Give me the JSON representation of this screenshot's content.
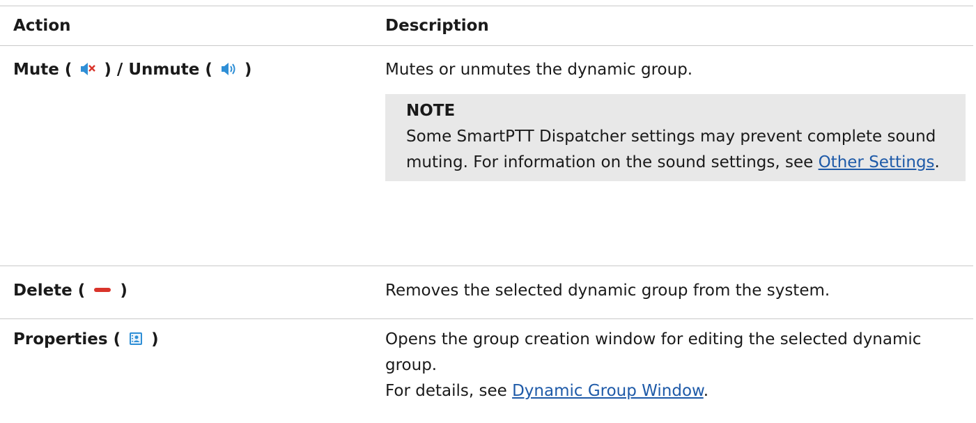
{
  "headers": {
    "action": "Action",
    "description": "Description"
  },
  "rows": [
    {
      "action_part1": "Mute (",
      "mute_icon": "speaker-muted-icon",
      "action_part2": ") / Unmute (",
      "unmute_icon": "speaker-icon",
      "action_part3": ")",
      "description": "Mutes or unmutes the dynamic group.",
      "note": {
        "title": "NOTE",
        "text": "Some SmartPTT Dispatcher settings may prevent complete sound muting. For information on the sound settings, see ",
        "link": "Other Settings",
        "tail": "."
      }
    },
    {
      "action_part1": "Delete (",
      "icon": "delete-minus-icon",
      "action_part2": ")",
      "description": "Removes the selected dynamic group from the system."
    },
    {
      "action_part1": "Properties (",
      "icon": "properties-card-icon",
      "action_part2": ")",
      "description_line1": "Opens the group creation window for editing the selected dynamic group.",
      "description_line2_prefix": "For details, see ",
      "description_line2_link": "Dynamic Group Window",
      "description_line2_tail": "."
    }
  ],
  "colors": {
    "link": "#1e5aa8",
    "note_bg": "#e8e8e8",
    "rule": "#c9c9c9",
    "mute_red": "#d9342b",
    "icon_blue": "#2f8fd6"
  }
}
